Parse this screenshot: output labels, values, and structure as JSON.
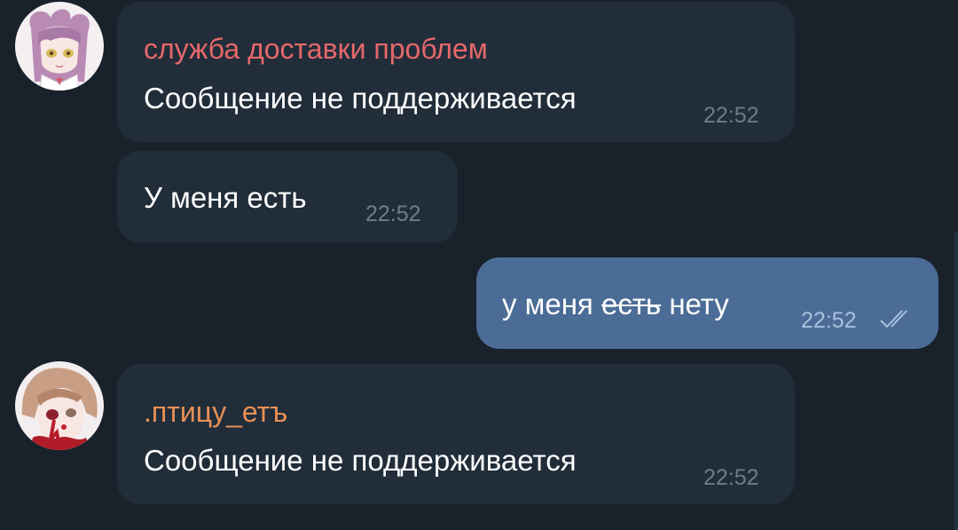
{
  "colors": {
    "background": "#19212b",
    "incoming_bubble": "#222d3a",
    "outgoing_bubble": "#4b6c96",
    "sender_1": "#e6686a",
    "sender_2": "#e89054",
    "timestamp": "#6d7b8c"
  },
  "messages": [
    {
      "sender": "служба доставки проблем",
      "text": "Сообщение не поддерживается",
      "time": "22:52"
    },
    {
      "text": "У меня есть",
      "time": "22:52"
    },
    {
      "text_before": "у меня",
      "text_struck": "есть",
      "text_after": "нету",
      "time": "22:52",
      "status_icon": "double-check-icon"
    },
    {
      "sender": ".птицу_етъ",
      "text": "Сообщение не поддерживается",
      "time": "22:52"
    }
  ]
}
